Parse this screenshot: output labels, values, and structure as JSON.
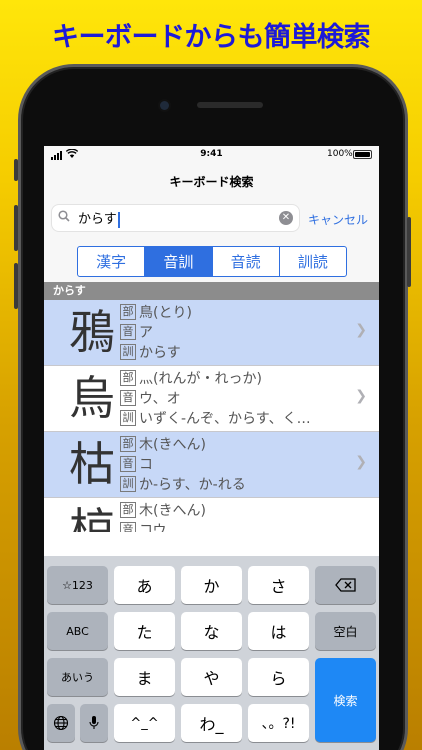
{
  "banner": {
    "text": "キーボードからも簡単検索"
  },
  "status_bar": {
    "time": "9:41",
    "battery": "100%"
  },
  "nav": {
    "title": "キーボード検索"
  },
  "search": {
    "value": "からす",
    "cancel_label": "キャンセル",
    "icon": "search-icon"
  },
  "segments": [
    {
      "label": "漢字",
      "active": false
    },
    {
      "label": "音訓",
      "active": true
    },
    {
      "label": "音読",
      "active": false
    },
    {
      "label": "訓読",
      "active": false
    }
  ],
  "section_header": "からす",
  "tags": {
    "radical": "部",
    "on": "音",
    "kun": "訓"
  },
  "results": [
    {
      "kanji": "鴉",
      "radical": "鳥(とり)",
      "on": "ア",
      "kun": "からす"
    },
    {
      "kanji": "烏",
      "radical": "灬(れんが・れっか)",
      "on": "ウ、オ",
      "kun": "いずく-んぞ、からす、く…"
    },
    {
      "kanji": "枯",
      "radical": "木(きへん)",
      "on": "コ",
      "kun": "か-らす、か-れる"
    },
    {
      "kanji": "椋",
      "radical": "木(きへん)",
      "on": "コウ",
      "kun": ""
    }
  ],
  "keyboard": {
    "row1": [
      "☆123",
      "あ",
      "か",
      "さ",
      "⌫"
    ],
    "row2": [
      "ABC",
      "た",
      "な",
      "は",
      "空白"
    ],
    "row3": [
      "あいう",
      "ま",
      "や",
      "ら"
    ],
    "row4": [
      "🌐",
      "🎤",
      "^_^",
      "わ_",
      "、。?!"
    ],
    "return_label": "検索"
  },
  "colors": {
    "accent": "#2f6fe0",
    "row_highlight": "#c7d8f7",
    "banner_text": "#1d1ad8"
  }
}
